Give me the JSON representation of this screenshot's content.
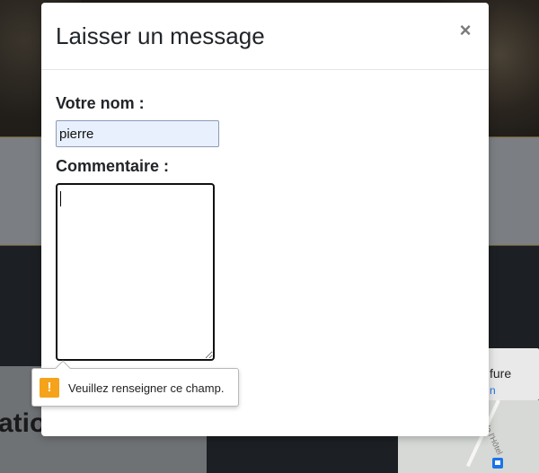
{
  "background": {
    "heading_fragment": "ations",
    "map_card_word": "fure",
    "map_card_link": "n",
    "street_label": "rue de l'Hôtel"
  },
  "modal": {
    "title": "Laisser un message",
    "close_symbol": "×",
    "name_label": "Votre nom :",
    "name_value": "pierre",
    "comment_label": "Commentaire :",
    "comment_value": ""
  },
  "validation": {
    "icon_symbol": "!",
    "message": "Veuillez renseigner ce champ."
  },
  "colors": {
    "warning": "#f5a31a",
    "autofill_bg": "#e8f0fe"
  }
}
